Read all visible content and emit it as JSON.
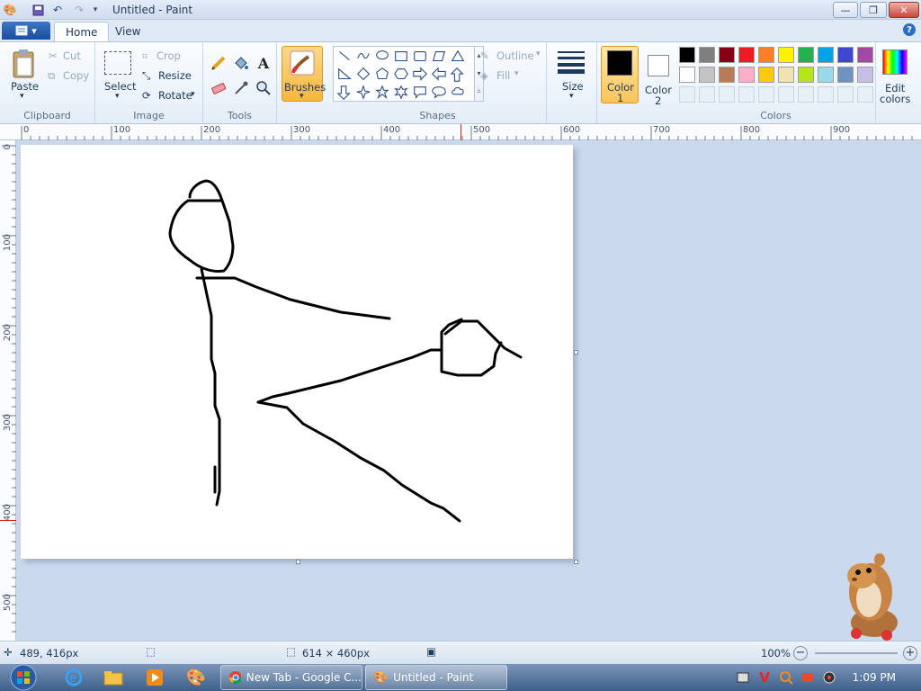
{
  "window": {
    "title": "Untitled - Paint",
    "buttons": {
      "minimize": "—",
      "maximize": "❐",
      "close": "✕"
    }
  },
  "tabs": {
    "home": "Home",
    "view": "View"
  },
  "clipboard": {
    "paste": "Paste",
    "cut": "Cut",
    "copy": "Copy",
    "group": "Clipboard"
  },
  "image": {
    "select": "Select",
    "crop": "Crop",
    "resize": "Resize",
    "rotate": "Rotate",
    "group": "Image"
  },
  "tools": {
    "group": "Tools"
  },
  "brushes": {
    "label": "Brushes"
  },
  "shapes": {
    "outline": "Outline",
    "fill": "Fill",
    "group": "Shapes"
  },
  "size": {
    "label": "Size"
  },
  "color1": {
    "line1": "Color",
    "line2": "1",
    "value": "#000000"
  },
  "color2": {
    "line1": "Color",
    "line2": "2",
    "value": "#ffffff"
  },
  "colors": {
    "group": "Colors",
    "edit_line1": "Edit",
    "edit_line2": "colors",
    "row1": [
      "#000000",
      "#7f7f7f",
      "#880015",
      "#ed1c24",
      "#ff7f27",
      "#fff200",
      "#22b14c",
      "#00a2e8",
      "#3f48cc",
      "#a349a4"
    ],
    "row2": [
      "#ffffff",
      "#c3c3c3",
      "#b97a57",
      "#ffaec9",
      "#ffc90e",
      "#efe4b0",
      "#b5e61d",
      "#99d9ea",
      "#7092be",
      "#c8bfe7"
    ]
  },
  "ruler": {
    "top": [
      "0",
      "100",
      "200",
      "300",
      "400",
      "500",
      "600",
      "700",
      "800",
      "900"
    ],
    "left": [
      "0",
      "100",
      "200",
      "300",
      "400",
      "500"
    ]
  },
  "status": {
    "cursor": "489, 416px",
    "selection": "",
    "canvas_size": "614 × 460px",
    "zoom": "100%"
  },
  "taskbar": {
    "tasks": [
      "New Tab - Google C...",
      "Untitled - Paint"
    ],
    "clock": "1:09 PM"
  }
}
